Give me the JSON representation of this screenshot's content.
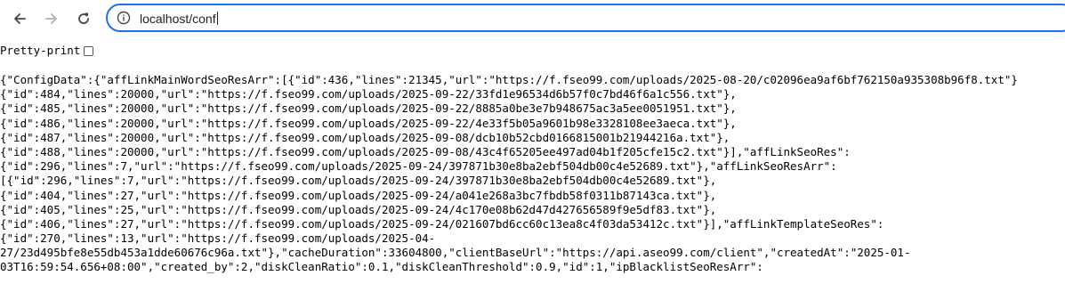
{
  "browser": {
    "url": "localhost/conf"
  },
  "pretty_print": {
    "label": "Pretty-print",
    "checked": false
  },
  "json_lines": [
    "{\"ConfigData\":{\"affLinkMainWordSeoResArr\":[{\"id\":436,\"lines\":21345,\"url\":\"https://f.fseo99.com/uploads/2025-08-20/c02096ea9af6bf762150a935308b96f8.txt\"}",
    "{\"id\":484,\"lines\":20000,\"url\":\"https://f.fseo99.com/uploads/2025-09-22/33fd1e96534d6b57f0c7bd46f6a1c556.txt\"},",
    "{\"id\":485,\"lines\":20000,\"url\":\"https://f.fseo99.com/uploads/2025-09-22/8885a0be3e7b948675ac3a5ee0051951.txt\"},",
    "{\"id\":486,\"lines\":20000,\"url\":\"https://f.fseo99.com/uploads/2025-09-22/4e33f5b05a9601b98e3328108ee3aeca.txt\"},",
    "{\"id\":487,\"lines\":20000,\"url\":\"https://f.fseo99.com/uploads/2025-09-08/dcb10b52cbd0166815001b21944216a.txt\"},",
    "{\"id\":488,\"lines\":20000,\"url\":\"https://f.fseo99.com/uploads/2025-09-08/43c4f65205ee497ad04b1f205cfe15c2.txt\"}],\"affLinkSeoRes\":",
    "{\"id\":296,\"lines\":7,\"url\":\"https://f.fseo99.com/uploads/2025-09-24/397871b30e8ba2ebf504db00c4e52689.txt\"},\"affLinkSeoResArr\":",
    "[{\"id\":296,\"lines\":7,\"url\":\"https://f.fseo99.com/uploads/2025-09-24/397871b30e8ba2ebf504db00c4e52689.txt\"},",
    "{\"id\":404,\"lines\":27,\"url\":\"https://f.fseo99.com/uploads/2025-09-24/a041e268a3bc7fbdb58f0311b87143ca.txt\"},",
    "{\"id\":405,\"lines\":25,\"url\":\"https://f.fseo99.com/uploads/2025-09-24/4c170e08b62d47d427656589f9e5df83.txt\"},",
    "{\"id\":406,\"lines\":27,\"url\":\"https://f.fseo99.com/uploads/2025-09-24/021607bd6cc60c13ea8c4f03da53412c.txt\"}],\"affLinkTemplateSeoRes\":",
    "{\"id\":270,\"lines\":13,\"url\":\"https://f.fseo99.com/uploads/2025-04-",
    "27/23d495bfe8e55db453a1dde60676c96a.txt\"},\"cacheDuration\":33604800,\"clientBaseUrl\":\"https://api.aseo99.com/client\",\"createdAt\":\"2025-01-",
    "03T16:59:54.656+08:00\",\"created_by\":2,\"diskCleanRatio\":0.1,\"diskCleanThreshold\":0.9,\"id\":1,\"ipBlacklistSeoResArr\":"
  ],
  "icons": {
    "back": "arrow-left-icon",
    "forward": "arrow-right-icon",
    "reload": "reload-icon",
    "site_info": "info-icon"
  },
  "colors": {
    "omnibox_border": "#1a73e8",
    "forward_disabled": "#b0b0b0",
    "icon": "#444746"
  }
}
